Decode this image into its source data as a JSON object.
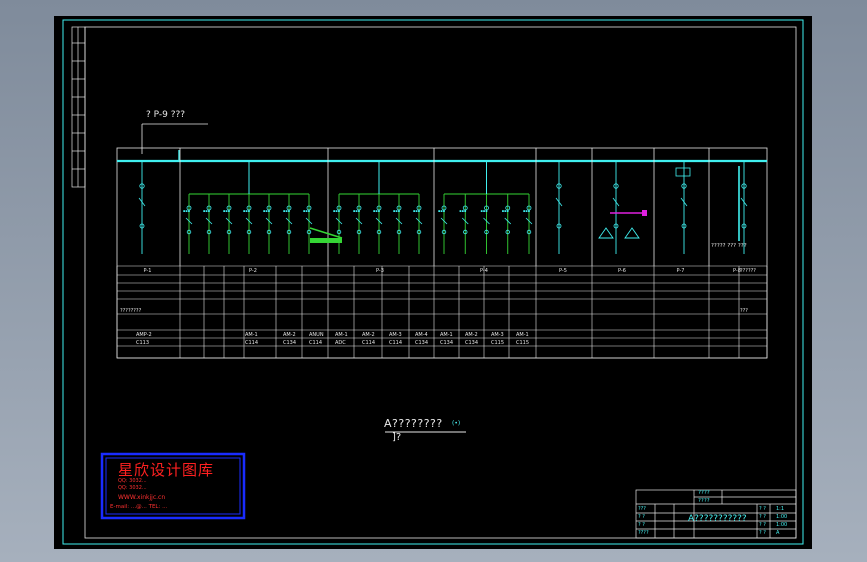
{
  "upper_label": "? P-9 ???",
  "diagram_title": "A????????",
  "diagram_title_tag": "(•)",
  "diagram_subtitle": "]?",
  "colors": {
    "background": "#000000",
    "line": "#e6e6e6",
    "bus": "#40f0f0",
    "text_cyan": "#47f0f0",
    "green": "#35d635",
    "magenta": "#e020e0",
    "logo_border": "#1a2cff",
    "logo_text": "#ff2020"
  },
  "panels": [
    {
      "label": "P-1",
      "rows": [
        "",
        "P-1"
      ]
    },
    {
      "label": "P-2",
      "rows": [
        "",
        "P-2"
      ]
    },
    {
      "label": "P-3",
      "rows": [
        "",
        "P-3"
      ]
    },
    {
      "label": "P-4",
      "rows": [
        "",
        "P-4"
      ]
    },
    {
      "label": "P-5",
      "rows": [
        "",
        "P-5"
      ]
    },
    {
      "label": "P-6",
      "rows": [
        "",
        "P-6"
      ]
    },
    {
      "label": "P-7",
      "rows": [
        "",
        "P-7"
      ]
    },
    {
      "label": "P-8",
      "rows": [
        "",
        "P-8"
      ]
    }
  ],
  "row_values": {
    "row_star": "??????",
    "row_type": "????????",
    "row_qmark": "???",
    "bottom_row": [
      "AMP-2",
      "",
      "AM-1",
      "AM-2",
      "ANUN",
      "AM-1",
      "AM-2",
      "AM-3",
      "AM-4",
      "AM-1",
      "AM-2",
      "AM-3",
      "AM-1",
      "",
      ""
    ],
    "code_row": [
      "C113",
      "",
      "C114",
      "C134",
      "C114",
      "ADC",
      "C114",
      "C114",
      "C134",
      "C134",
      "C134",
      "C115",
      "C115",
      "",
      ""
    ]
  },
  "side_value": "????? ??? ???",
  "logo": {
    "title": "星欣设计图库",
    "line1": "QQ: 3032...",
    "line2": "QQ: 3032...",
    "web": "WWW.xinkjjc.cn",
    "contact": "E-mail: ...@...  TEL: ..."
  },
  "title_block": {
    "drawing_name": "A???????????",
    "cells_top": [
      "????",
      "????"
    ],
    "cells_left": [
      "???",
      "? ?",
      "? ?",
      "????"
    ],
    "cells_right": [
      "? ?",
      "? ?",
      "? ?",
      "? ?"
    ],
    "right_vals": [
      "1:1",
      "1:00",
      "1:00",
      "A"
    ]
  }
}
